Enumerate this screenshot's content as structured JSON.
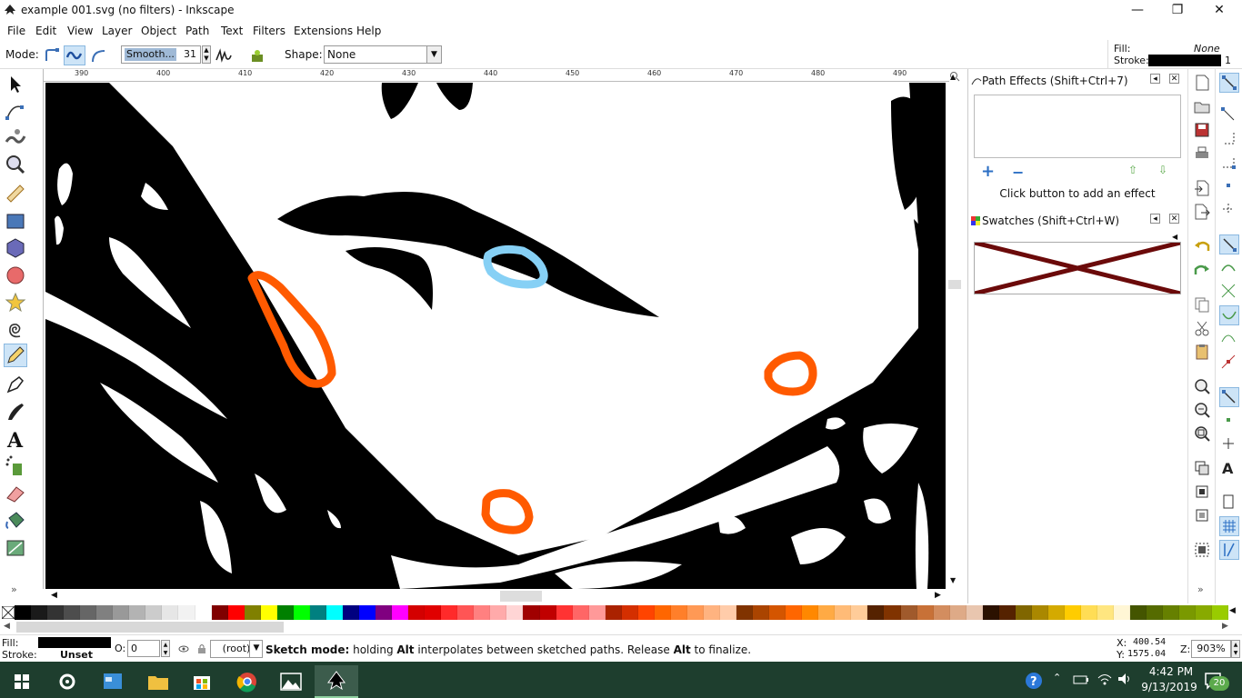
{
  "window": {
    "title": "example 001.svg (no filters) - Inkscape",
    "minimize_glyph": "—",
    "maximize_glyph": "❐",
    "close_glyph": "✕"
  },
  "menu": [
    "File",
    "Edit",
    "View",
    "Layer",
    "Object",
    "Path",
    "Text",
    "Filters",
    "Extensions",
    "Help"
  ],
  "tool_controls": {
    "mode_label": "Mode:",
    "smoothing_label": "Smooth...",
    "smoothing_value": "31",
    "shape_label": "Shape:",
    "shape_value": "None"
  },
  "style_indicator": {
    "fill_label": "Fill:",
    "fill_value": "None",
    "stroke_label": "Stroke:",
    "stroke_width": "1",
    "stroke_color": "#000000"
  },
  "ruler": {
    "h_ticks": [
      "390",
      "400",
      "410",
      "420",
      "430",
      "440",
      "450",
      "460",
      "470",
      "480",
      "490"
    ]
  },
  "canvas": {
    "highlight_blue": "#86d0f5",
    "highlight_orange": "#ff5a00"
  },
  "dock": {
    "path_effects_title": "Path Effects  (Shift+Ctrl+7)",
    "path_effects_hint": "Click button to add an effect",
    "swatches_title": "Swatches (Shift+Ctrl+W)"
  },
  "palette": {
    "colors": [
      "#000000",
      "#1a1a1a",
      "#333333",
      "#4d4d4d",
      "#666666",
      "#808080",
      "#999999",
      "#b3b3b3",
      "#cccccc",
      "#e6e6e6",
      "#f2f2f2",
      "#ffffff",
      "#800000",
      "#ff0000",
      "#808000",
      "#ffff00",
      "#008000",
      "#00ff00",
      "#008080",
      "#00ffff",
      "#000080",
      "#0000ff",
      "#800080",
      "#ff00ff",
      "#d40000",
      "#e00000",
      "#ff2a2a",
      "#ff5555",
      "#ff8080",
      "#ffaaaa",
      "#ffd5d5",
      "#a00000",
      "#c00000",
      "#ff3333",
      "#ff6666",
      "#ff9999",
      "#aa2200",
      "#d42f00",
      "#ff4400",
      "#ff6600",
      "#ff7f2a",
      "#ff9955",
      "#ffb380",
      "#ffccaa",
      "#803300",
      "#aa4400",
      "#d45500",
      "#ff6600",
      "#ff8800",
      "#ffaa44",
      "#ffbb77",
      "#ffcc99",
      "#552200",
      "#803300",
      "#a05a2c",
      "#c87137",
      "#d38d5f",
      "#deaa87",
      "#e9c6af",
      "#2b1100",
      "#552200",
      "#806600",
      "#aa8800",
      "#d4aa00",
      "#ffcc00",
      "#ffdd55",
      "#ffe680",
      "#fff6d5",
      "#445500",
      "#556b00",
      "#668000",
      "#7a9900",
      "#88aa00",
      "#99cc00"
    ]
  },
  "status": {
    "fill_label": "Fill:",
    "stroke_label": "Stroke:",
    "stroke_value": "Unset",
    "opacity_label": "O:",
    "opacity_value": "0",
    "layer_value": "(root)",
    "message_bold1": "Sketch mode:",
    "message_part1": " holding ",
    "message_bold2": "Alt",
    "message_part2": " interpolates between sketched paths. Release ",
    "message_bold3": "Alt",
    "message_part3": " to finalize.",
    "x_label": "X:",
    "x_value": "400.54",
    "y_label": "Y:",
    "y_value": "1575.04",
    "zoom_label": "Z:",
    "zoom_value": "903%"
  },
  "taskbar": {
    "time": "4:42 PM",
    "date": "9/13/2019",
    "notifications": "20"
  }
}
